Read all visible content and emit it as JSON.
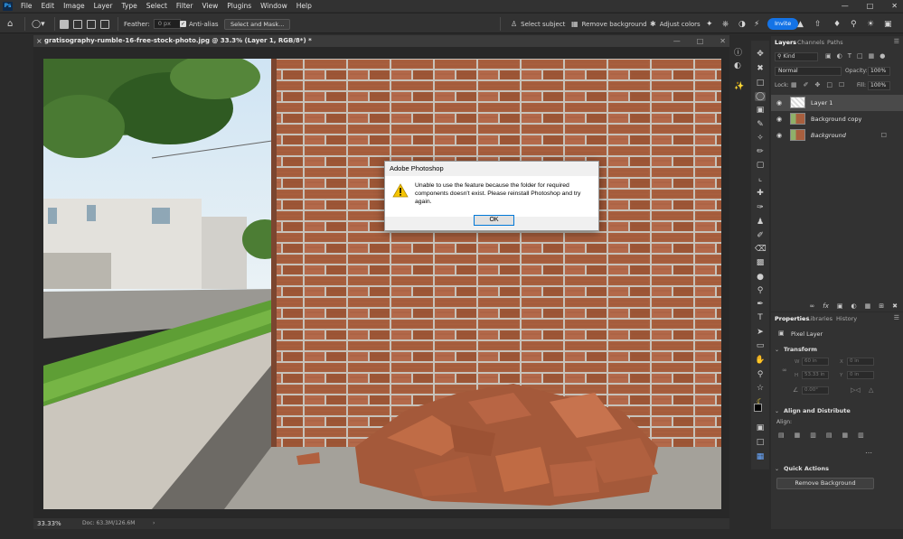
{
  "menu": {
    "logo": "Ps",
    "items": [
      "File",
      "Edit",
      "Image",
      "Layer",
      "Type",
      "Select",
      "Filter",
      "View",
      "Plugins",
      "Window",
      "Help"
    ]
  },
  "options": {
    "feather_label": "Feather:",
    "feather_value": "0 px",
    "antialias_label": "Anti-alias",
    "select_mask": "Select and Mask...",
    "select_subject": "Select subject",
    "remove_background": "Remove background",
    "adjust_colors": "Adjust colors",
    "invite": "Invite"
  },
  "document": {
    "title": "gratisography-rumble-16-free-stock-photo.jpg @ 33.3% (Layer 1, RGB/8*) *",
    "zoom": "33.33%",
    "doc_info": "Doc: 63.3M/126.6M"
  },
  "layers": {
    "tabs": [
      "Layers",
      "Channels",
      "Paths"
    ],
    "filter_kind": "Kind",
    "blend_mode": "Normal",
    "opacity_label": "Opacity:",
    "opacity_value": "100%",
    "lock_label": "Lock:",
    "fill_label": "Fill:",
    "fill_value": "100%",
    "items": [
      {
        "name": "Layer 1"
      },
      {
        "name": "Background copy"
      },
      {
        "name": "Background"
      }
    ]
  },
  "properties": {
    "tabs": [
      "Properties",
      "Libraries",
      "History"
    ],
    "layer_type": "Pixel Layer",
    "transform_title": "Transform",
    "w_label": "W",
    "w_value": "60 in",
    "h_label": "H",
    "h_value": "53.33 in",
    "x_label": "X",
    "x_value": "0 in",
    "y_label": "Y",
    "y_value": "0 in",
    "angle_value": "0.00°",
    "align_title": "Align and Distribute",
    "align_label": "Align:",
    "quick_actions_title": "Quick Actions",
    "remove_bg_button": "Remove Background"
  },
  "dialog": {
    "title": "Adobe Photoshop",
    "message": "Unable to use the feature because the folder for required components doesn't exist. Please reinstall Photoshop and try again.",
    "ok": "OK"
  },
  "colors": {
    "accent": "#1473e6",
    "panel": "#323232",
    "dialog_bg": "#ffffff"
  }
}
